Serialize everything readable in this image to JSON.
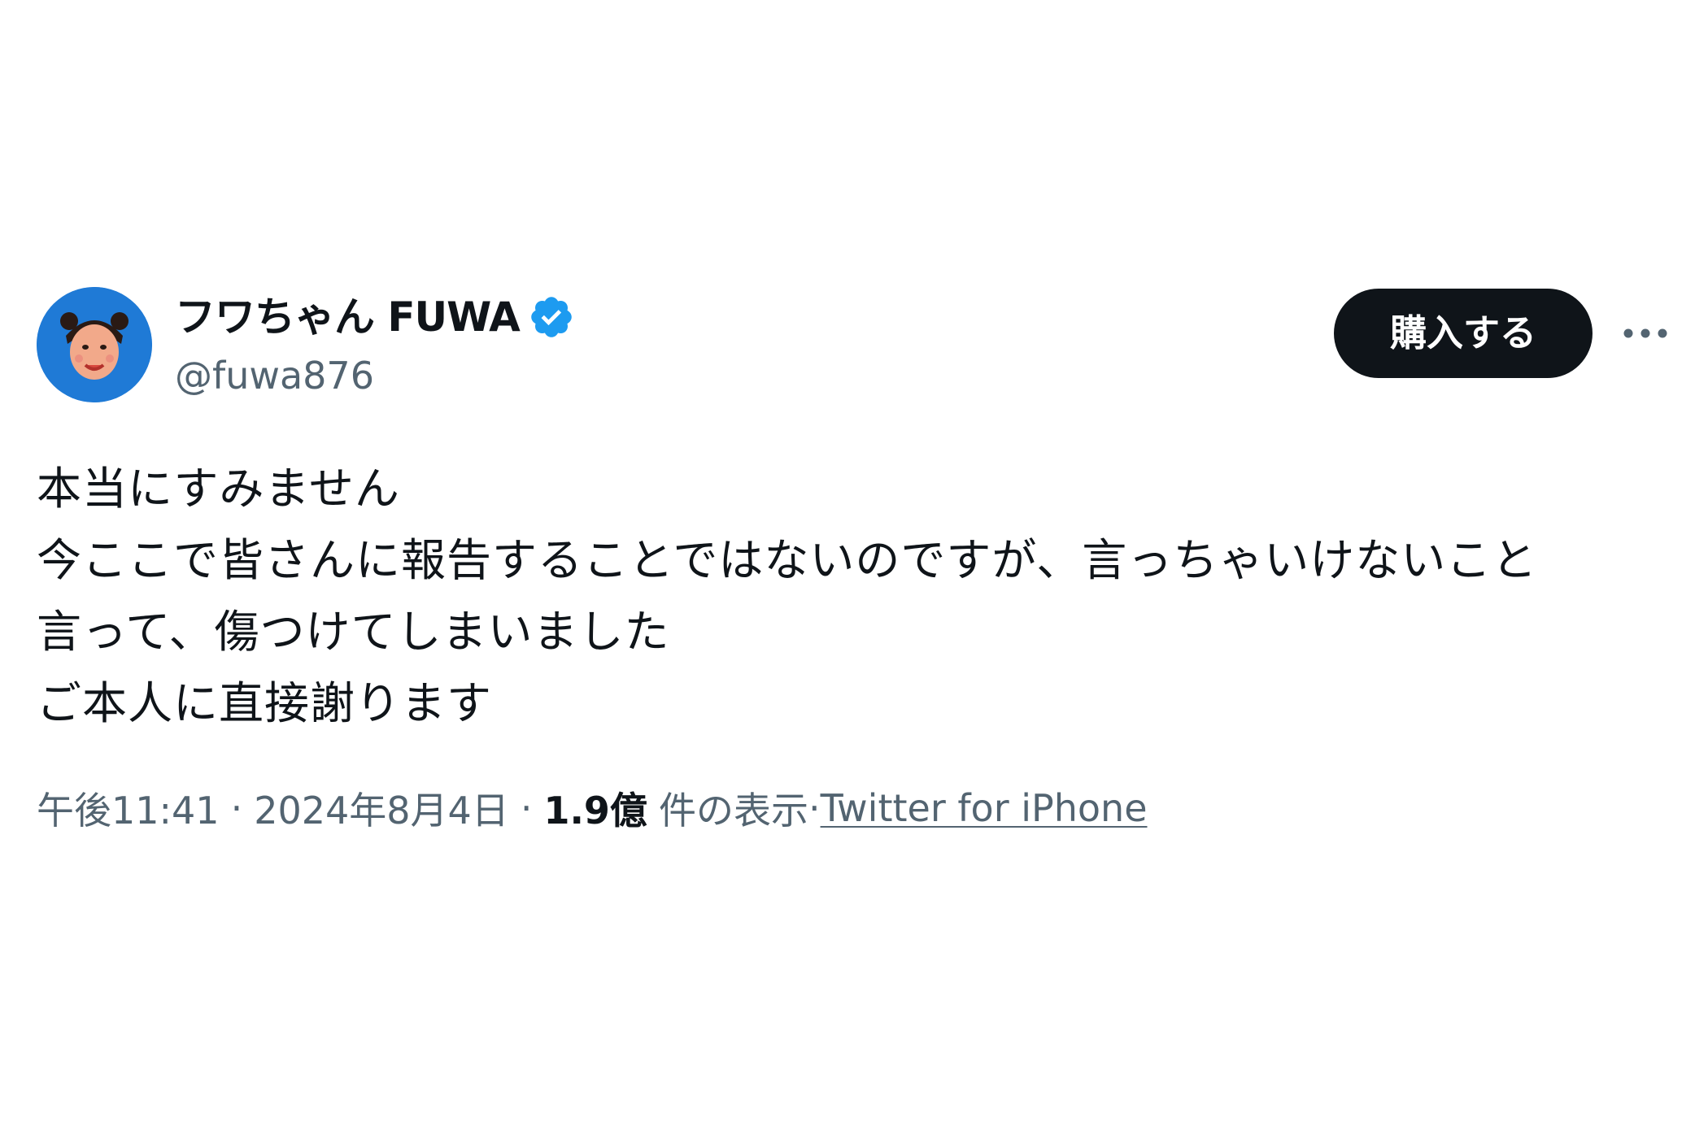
{
  "tweet": {
    "author": {
      "display_name": "フワちゃん FUWA",
      "handle": "@fuwa876",
      "verified_icon": "verified-badge-icon",
      "avatar_color": "#1f7ad6"
    },
    "buy_button_label": "購入する",
    "more_icon": "more-horizontal-icon",
    "text_lines": [
      "本当にすみません",
      "今ここで皆さんに報告することではないのですが、言っちゃいけないこと",
      "言って、傷つけてしまいました",
      "ご本人に直接謝ります"
    ],
    "meta": {
      "time": "午後11:41",
      "separator": "·",
      "date": "2024年8月4日",
      "views_count": "1.9億",
      "views_label": "件の表示",
      "source": "Twitter for iPhone"
    }
  },
  "colors": {
    "text_primary": "#0f1419",
    "text_secondary": "#536471",
    "verified_blue": "#1d9bf0",
    "button_bg": "#0f1419"
  }
}
